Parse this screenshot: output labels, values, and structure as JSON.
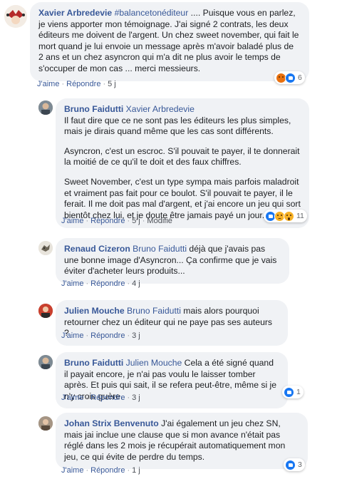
{
  "ui": {
    "like_label": "J'aime",
    "reply_label": "Répondre",
    "separator": "·"
  },
  "colors": {
    "name_link": "#385898",
    "bubble_bg": "#f0f2f5",
    "like_blue": "#1877f2",
    "angry_orange": "#e9710f",
    "sad_yellow": "#f7b125"
  },
  "comments": [
    {
      "author": "Xavier Arbredevie",
      "tag": "#balancetonéditeur",
      "text": " .... Puisque vous en parlez, je viens apporter mon témoignage. J'ai signé 2 contrats, les deux éditeurs me doivent de l'argent. Un chez sweet november, qui fait le mort quand je lui envoie un message après m'avoir baladé plus de 2 ans et un chez asyncron qui m'a dit ne plus avoir le temps de s'occuper de mon cas ... merci messieurs.",
      "time": "5 j",
      "reactions": {
        "icons": [
          "angry-icon",
          "like-icon"
        ],
        "count": "6"
      }
    },
    {
      "author": "Bruno Faidutti",
      "mention": "Xavier Arbredevie",
      "paragraphs": [
        "Il faut dire que ce ne sont pas les éditeurs les plus simples, mais je dirais quand même que les cas sont différents.",
        "Asyncron, c'est un escroc. S'il pouvait te payer, il te donnerait la moitié de ce qu'il te doit et des faux chiffres.",
        "Sweet November, c'est un type sympa mais parfois maladroit et vraiment pas fait pour ce boulot. S'il pouvait te payer, il le ferait. Il me doit pas mal d'argent, et j'ai encore un jeu qui sort bientôt chez lui, et je doute être jamais payé un jour."
      ],
      "time": "5 j",
      "edited": "Modifié",
      "reactions": {
        "icons": [
          "like-icon",
          "sad-icon",
          "wow-icon"
        ],
        "count": "11"
      }
    },
    {
      "author": "Renaud Cizeron",
      "mention": "Bruno Faidutti",
      "text": " déjà que j'avais pas une bonne image d'Asyncron... Ça confirme que je vais éviter d'acheter leurs produits...",
      "time": "4 j"
    },
    {
      "author": "Julien Mouche",
      "mention": "Bruno Faidutti",
      "text": " mais alors pourquoi retourner chez un éditeur qui ne paye pas ses auteurs ?",
      "time": "3 j"
    },
    {
      "author": "Bruno Faidutti",
      "mention": "Julien Mouche",
      "text": " Cela a été signé quand il payait encore, je n'ai pas voulu le laisser tomber après. Et puis qui sait, il se refera peut-être, même si je n'y crois guère.",
      "time": "3 j",
      "reactions": {
        "icons": [
          "like-icon"
        ],
        "count": "1"
      }
    },
    {
      "author": "Johan Strix Benvenuto",
      "text": " J'ai également un jeu chez SN, mais jai inclue une clause que si mon avance n'était pas réglé dans les 2 mois je récupérait automatiquement mon jeu, ce qui évite de perdre du temps.",
      "time": "1 j",
      "reactions": {
        "icons": [
          "like-icon"
        ],
        "count": "3"
      }
    }
  ]
}
